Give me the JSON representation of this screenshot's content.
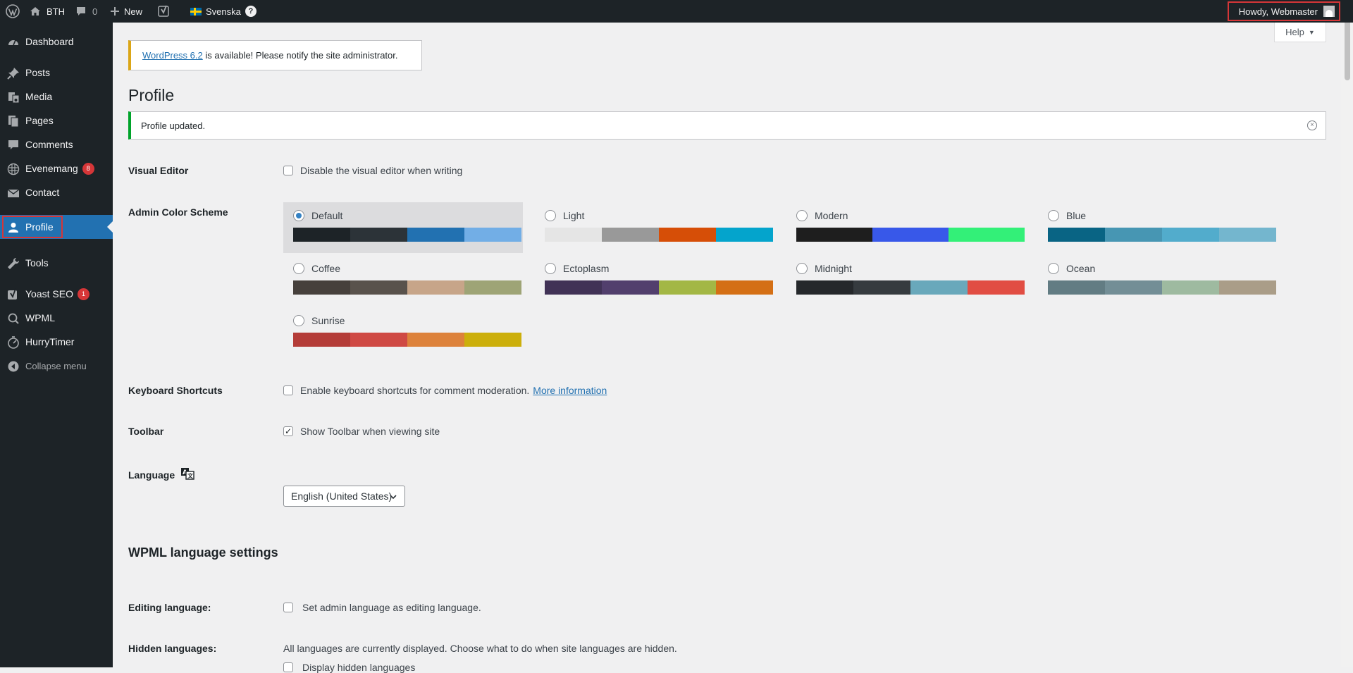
{
  "adminbar": {
    "site_name": "BTH",
    "comments_count": "0",
    "new_label": "New",
    "language_label": "Svenska",
    "howdy": "Howdy, Webmaster"
  },
  "sidebar": {
    "items": [
      {
        "label": "Dashboard",
        "icon": "dashboard-icon"
      },
      {
        "label": "Posts",
        "icon": "pushpin-icon"
      },
      {
        "label": "Media",
        "icon": "media-icon"
      },
      {
        "label": "Pages",
        "icon": "pages-icon"
      },
      {
        "label": "Comments",
        "icon": "comment-icon"
      },
      {
        "label": "Evenemang",
        "icon": "calendar-icon",
        "badge": "8"
      },
      {
        "label": "Contact",
        "icon": "mail-icon"
      },
      {
        "label": "Profile",
        "icon": "user-icon"
      },
      {
        "label": "Tools",
        "icon": "wrench-icon"
      },
      {
        "label": "Yoast SEO",
        "icon": "yoast-icon",
        "badge": "1"
      },
      {
        "label": "WPML",
        "icon": "wpml-icon"
      },
      {
        "label": "HurryTimer",
        "icon": "timer-icon"
      },
      {
        "label": "Collapse menu",
        "icon": "collapse-icon"
      }
    ]
  },
  "help_label": "Help",
  "update_nag": {
    "link_text": "WordPress 6.2",
    "text": " is available! Please notify the site administrator."
  },
  "page_title": "Profile",
  "notice": "Profile updated.",
  "visual_editor": {
    "label": "Visual Editor",
    "option": "Disable the visual editor when writing",
    "checked": false
  },
  "color_scheme": {
    "label": "Admin Color Scheme",
    "selected": "Default",
    "schemes": [
      {
        "name": "Default",
        "colors": [
          "#1d2327",
          "#2c3338",
          "#2271b1",
          "#72aee6"
        ]
      },
      {
        "name": "Light",
        "colors": [
          "#e5e5e5",
          "#999999",
          "#d64e07",
          "#04a4cc"
        ]
      },
      {
        "name": "Modern",
        "colors": [
          "#1e1e1e",
          "#3858e9",
          "#33f078"
        ]
      },
      {
        "name": "Blue",
        "colors": [
          "#096484",
          "#4796b3",
          "#52accc",
          "#74b6ce"
        ]
      },
      {
        "name": "Coffee",
        "colors": [
          "#46403c",
          "#59524c",
          "#c7a589",
          "#9ea476"
        ]
      },
      {
        "name": "Ectoplasm",
        "colors": [
          "#413256",
          "#523f6d",
          "#a3b745",
          "#d46f15"
        ]
      },
      {
        "name": "Midnight",
        "colors": [
          "#25282b",
          "#363b3f",
          "#69a8bb",
          "#e14d43"
        ]
      },
      {
        "name": "Ocean",
        "colors": [
          "#627c83",
          "#738e96",
          "#9ebaa0",
          "#aa9d88"
        ]
      },
      {
        "name": "Sunrise",
        "colors": [
          "#b43c38",
          "#cf4944",
          "#dd823b",
          "#ccaf0b"
        ]
      }
    ]
  },
  "keyboard": {
    "label": "Keyboard Shortcuts",
    "option": "Enable keyboard shortcuts for comment moderation.",
    "link": "More information",
    "checked": false
  },
  "toolbar": {
    "label": "Toolbar",
    "option": "Show Toolbar when viewing site",
    "checked": true
  },
  "language": {
    "label": "Language",
    "value": "English (United States)"
  },
  "wpml": {
    "section_title": "WPML language settings",
    "editing_label": "Editing language:",
    "editing_option": "Set admin language as editing language.",
    "hidden_label": "Hidden languages:",
    "hidden_text": "All languages are currently displayed. Choose what to do when site languages are hidden.",
    "hidden_option": "Display hidden languages"
  }
}
